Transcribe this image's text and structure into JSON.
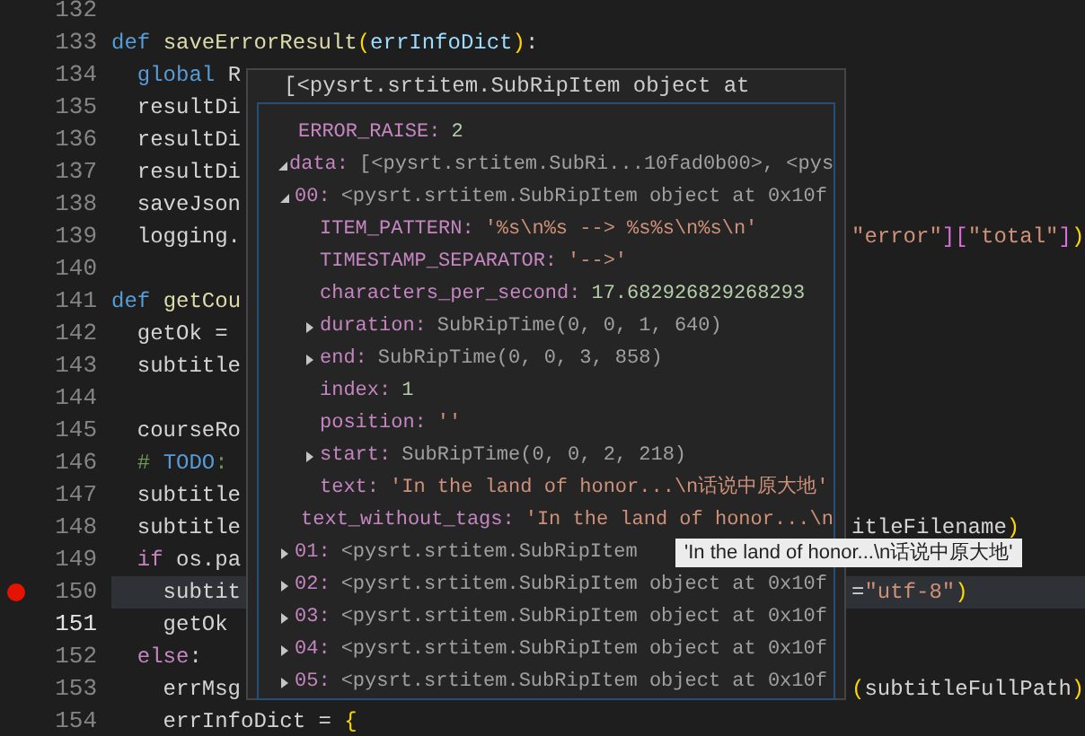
{
  "editor": {
    "lines": [
      {
        "number": "132"
      },
      {
        "number": "133",
        "left": [
          {
            "text": "def ",
            "kind": "kw"
          },
          {
            "text": "saveErrorResult",
            "kind": "fn"
          },
          {
            "text": "(",
            "kind": "br1"
          },
          {
            "text": "errInfoDict",
            "kind": "param"
          },
          {
            "text": ")",
            "kind": "br1"
          },
          {
            "text": ":",
            "kind": "var"
          }
        ]
      },
      {
        "number": "134",
        "left": [
          {
            "text": "  global ",
            "kind": "kw"
          },
          {
            "text": "R",
            "kind": "var"
          }
        ]
      },
      {
        "number": "135",
        "left": [
          {
            "text": "  resultDi",
            "kind": "var"
          }
        ]
      },
      {
        "number": "136",
        "left": [
          {
            "text": "  resultDi",
            "kind": "var"
          }
        ]
      },
      {
        "number": "137",
        "left": [
          {
            "text": "  resultDi",
            "kind": "var"
          }
        ]
      },
      {
        "number": "138",
        "left": [
          {
            "text": "  saveJson",
            "kind": "var"
          }
        ]
      },
      {
        "number": "139",
        "left": [
          {
            "text": "  logging.",
            "kind": "var"
          }
        ],
        "right": [
          {
            "text": "\"error\"",
            "kind": "str"
          },
          {
            "text": "][",
            "kind": "br2"
          },
          {
            "text": "\"total\"",
            "kind": "str"
          },
          {
            "text": "]",
            "kind": "br2"
          },
          {
            "text": ")",
            "kind": "br1"
          }
        ]
      },
      {
        "number": "140"
      },
      {
        "number": "141",
        "left": [
          {
            "text": "def ",
            "kind": "kw"
          },
          {
            "text": "getCou",
            "kind": "fn"
          }
        ]
      },
      {
        "number": "142",
        "left": [
          {
            "text": "  getOk =",
            "kind": "var"
          }
        ]
      },
      {
        "number": "143",
        "left": [
          {
            "text": "  subtitle",
            "kind": "var"
          }
        ]
      },
      {
        "number": "144"
      },
      {
        "number": "145",
        "left": [
          {
            "text": "  courseRo",
            "kind": "var"
          }
        ]
      },
      {
        "number": "146",
        "left": [
          {
            "text": "  # ",
            "kind": "cmt"
          },
          {
            "text": "TODO",
            "kind": "kw"
          },
          {
            "text": ":",
            "kind": "cmt"
          }
        ]
      },
      {
        "number": "147",
        "left": [
          {
            "text": "  subtitle",
            "kind": "var"
          }
        ]
      },
      {
        "number": "148",
        "left": [
          {
            "text": "  subtitle",
            "kind": "var"
          }
        ],
        "right": [
          {
            "text": "itleFilename",
            "kind": "var"
          },
          {
            "text": ")",
            "kind": "br1"
          }
        ]
      },
      {
        "number": "149",
        "left": [
          {
            "text": "  if ",
            "kind": "ctl"
          },
          {
            "text": "os.pa",
            "kind": "var"
          }
        ]
      },
      {
        "number": "150",
        "breakpoint": true,
        "highlighted": true,
        "left": [
          {
            "text": "    subtit",
            "kind": "var"
          }
        ],
        "right": [
          {
            "text": "=",
            "kind": "var"
          },
          {
            "text": "\"utf-8\"",
            "kind": "str"
          },
          {
            "text": ")",
            "kind": "br1"
          }
        ]
      },
      {
        "number": "151",
        "current": true,
        "left": [
          {
            "text": "    getOk",
            "kind": "var"
          }
        ]
      },
      {
        "number": "152",
        "left": [
          {
            "text": "  else",
            "kind": "ctl"
          },
          {
            "text": ":",
            "kind": "var"
          }
        ]
      },
      {
        "number": "153",
        "left": [
          {
            "text": "    errMsg",
            "kind": "var"
          }
        ],
        "right": [
          {
            "text": "(",
            "kind": "br1"
          },
          {
            "text": "subtitleFullPath",
            "kind": "var"
          },
          {
            "text": ")",
            "kind": "br1"
          }
        ]
      },
      {
        "number": "154",
        "left": [
          {
            "text": "    errInfoDict = ",
            "kind": "var"
          },
          {
            "text": "{",
            "kind": "br1"
          }
        ]
      }
    ]
  },
  "hover": {
    "title": "[<pysrt.srtitem.SubRipItem object at",
    "tree": [
      {
        "key": "ERROR_RAISE:",
        "value": "2",
        "kind": "number"
      },
      {
        "key": "data:",
        "value": "[<pysrt.srtitem.SubRi...10fad0b00>, <pys",
        "kind": "object",
        "expanded": true,
        "children": [
          {
            "key": "00:",
            "value": "<pysrt.srtitem.SubRipItem object at 0x10f",
            "kind": "object",
            "expanded": true,
            "children": [
              {
                "key": "ITEM_PATTERN:",
                "value": "'%s\\n%s --> %s%s\\n%s\\n'",
                "kind": "string"
              },
              {
                "key": "TIMESTAMP_SEPARATOR:",
                "value": "'-->'",
                "kind": "string"
              },
              {
                "key": "characters_per_second:",
                "value": "17.682926829268293",
                "kind": "number"
              },
              {
                "key": "duration:",
                "value": "SubRipTime(0, 0, 1, 640)",
                "kind": "object",
                "expanded": false
              },
              {
                "key": "end:",
                "value": "SubRipTime(0, 0, 3, 858)",
                "kind": "object",
                "expanded": false
              },
              {
                "key": "index:",
                "value": "1",
                "kind": "number"
              },
              {
                "key": "position:",
                "value": "''",
                "kind": "string"
              },
              {
                "key": "start:",
                "value": "SubRipTime(0, 0, 2, 218)",
                "kind": "object",
                "expanded": false
              },
              {
                "key": "text:",
                "value": "'In the land of honor...\\n话说中原大地'",
                "kind": "string"
              },
              {
                "key": "text_without_tags:",
                "value": "'In the land of honor...\\n",
                "kind": "string"
              }
            ]
          },
          {
            "key": "01:",
            "value": "<pysrt.srtitem.SubRipItem",
            "kind": "object",
            "expanded": false
          },
          {
            "key": "02:",
            "value": "<pysrt.srtitem.SubRipItem object at 0x10f",
            "kind": "object",
            "expanded": false
          },
          {
            "key": "03:",
            "value": "<pysrt.srtitem.SubRipItem object at 0x10f",
            "kind": "object",
            "expanded": false
          },
          {
            "key": "04:",
            "value": "<pysrt.srtitem.SubRipItem object at 0x10f",
            "kind": "object",
            "expanded": false
          },
          {
            "key": "05:",
            "value": "<pysrt.srtitem.SubRipItem object at 0x10f",
            "kind": "object",
            "expanded": false
          }
        ]
      }
    ]
  },
  "tooltip": {
    "text": "'In the land of honor...\\n话说中原大地'"
  }
}
